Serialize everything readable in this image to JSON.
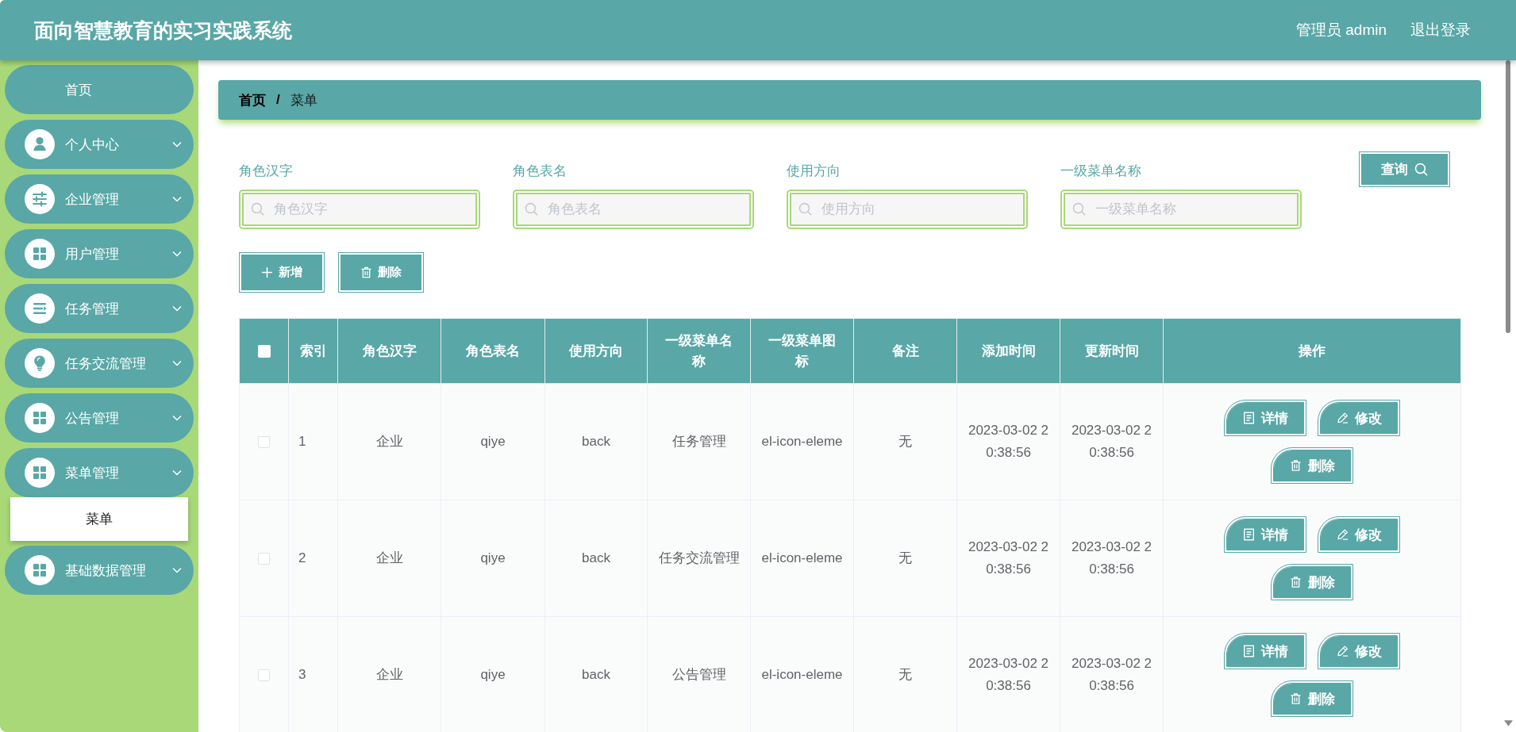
{
  "header": {
    "title": "面向智慧教育的实习实践系统",
    "user": "管理员 admin",
    "logout": "退出登录"
  },
  "sidebar": {
    "items": [
      {
        "label": "首页",
        "kind": "link"
      },
      {
        "label": "个人中心",
        "kind": "submenu"
      },
      {
        "label": "企业管理",
        "kind": "submenu"
      },
      {
        "label": "用户管理",
        "kind": "submenu"
      },
      {
        "label": "任务管理",
        "kind": "submenu"
      },
      {
        "label": "任务交流管理",
        "kind": "submenu"
      },
      {
        "label": "公告管理",
        "kind": "submenu"
      },
      {
        "label": "菜单管理",
        "kind": "submenu",
        "children": [
          {
            "label": "菜单",
            "selected": true
          }
        ]
      },
      {
        "label": "基础数据管理",
        "kind": "submenu"
      }
    ]
  },
  "breadcrumb": {
    "items": [
      "首页",
      "菜单"
    ],
    "separator": "/"
  },
  "search": {
    "fields": [
      {
        "label": "角色汉字",
        "placeholder": "角色汉字"
      },
      {
        "label": "角色表名",
        "placeholder": "角色表名"
      },
      {
        "label": "使用方向",
        "placeholder": "使用方向"
      },
      {
        "label": "一级菜单名称",
        "placeholder": "一级菜单名称"
      }
    ],
    "button": "查询"
  },
  "toolbar": [
    {
      "label": "新增",
      "kind": "add"
    },
    {
      "label": "删除",
      "kind": "delete"
    }
  ],
  "table": {
    "select_all": {
      "checked": false
    },
    "columns": [
      "索引",
      "角色汉字",
      "角色表名",
      "使用方向",
      "一级菜单名称",
      "一级菜单图标",
      "备注",
      "添加时间",
      "更新时间",
      "操作"
    ],
    "rows": [
      {
        "checked": false,
        "cells": [
          "1",
          "企业",
          "qiye",
          "back",
          "任务管理",
          "el-icon-eleme",
          "无",
          "2023-03-02 20:38:56",
          "2023-03-02 20:38:56"
        ],
        "actions": [
          {
            "label": "详情",
            "kind": "detail"
          },
          {
            "label": "修改",
            "kind": "edit"
          },
          {
            "label": "删除",
            "kind": "delete"
          }
        ]
      },
      {
        "checked": false,
        "cells": [
          "2",
          "企业",
          "qiye",
          "back",
          "任务交流管理",
          "el-icon-eleme",
          "无",
          "2023-03-02 20:38:56",
          "2023-03-02 20:38:56"
        ],
        "actions": [
          {
            "label": "详情",
            "kind": "detail"
          },
          {
            "label": "修改",
            "kind": "edit"
          },
          {
            "label": "删除",
            "kind": "delete"
          }
        ]
      },
      {
        "checked": false,
        "cells": [
          "3",
          "企业",
          "qiye",
          "back",
          "公告管理",
          "el-icon-eleme",
          "无",
          "2023-03-02 20:38:56",
          "2023-03-02 20:38:56"
        ],
        "actions": [
          {
            "label": "详情",
            "kind": "detail"
          },
          {
            "label": "修改",
            "kind": "edit"
          },
          {
            "label": "删除",
            "kind": "delete"
          }
        ]
      }
    ]
  }
}
